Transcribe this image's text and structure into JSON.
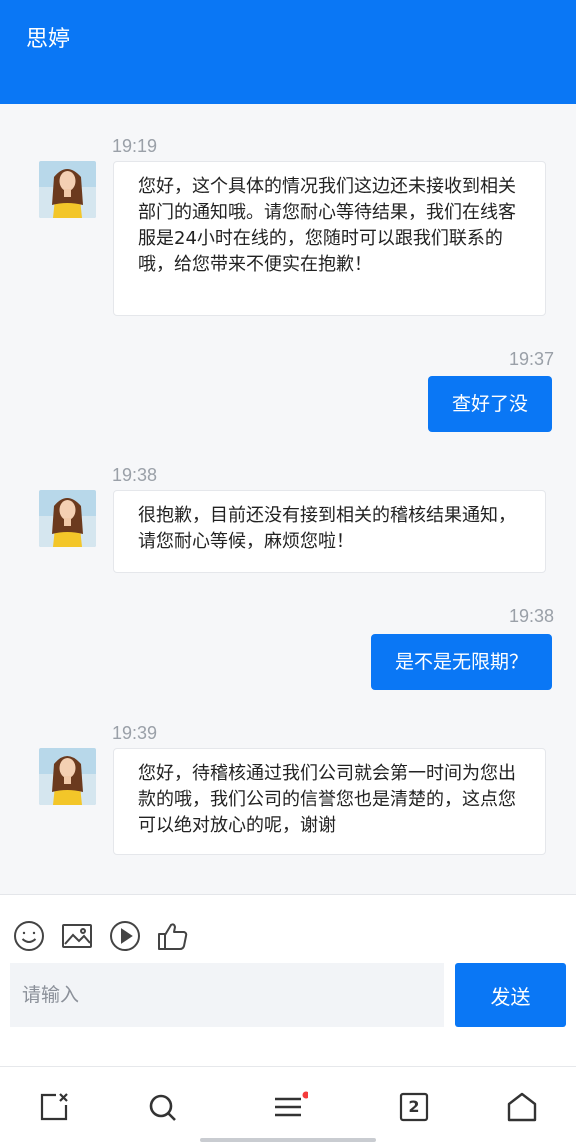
{
  "header": {
    "title": "思婷"
  },
  "messages": [
    {
      "side": "in",
      "time": "19:19",
      "text": "您好，这个具体的情况我们这边还未接收到相关部门的通知哦。请您耐心等待结果，我们在线客服是24小时在线的，您随时可以跟我们联系的哦，给您带来不便实在抱歉！"
    },
    {
      "side": "out",
      "time": "19:37",
      "text": "查好了没"
    },
    {
      "side": "in",
      "time": "19:38",
      "text": "很抱歉，目前还没有接到相关的稽核结果通知，请您耐心等候，麻烦您啦！"
    },
    {
      "side": "out",
      "time": "19:38",
      "text": "是不是无限期？"
    },
    {
      "side": "in",
      "time": "19:39",
      "text": "您好，待稽核通过我们公司就会第一时间为您出款的哦，我们公司的信誉您也是清楚的，这点您可以绝对放心的呢，谢谢"
    }
  ],
  "composer": {
    "placeholder": "请输入",
    "send_label": "发送",
    "tools": [
      "emoji-icon",
      "image-icon",
      "video-icon",
      "thumbs-up-icon"
    ]
  },
  "navbar": {
    "items": [
      "close-tab-icon",
      "search-icon",
      "menu-icon",
      "tabs-icon",
      "home-icon"
    ],
    "tab_count": "2",
    "badge_color": "#f53b3b"
  },
  "colors": {
    "accent": "#0a77f5"
  }
}
